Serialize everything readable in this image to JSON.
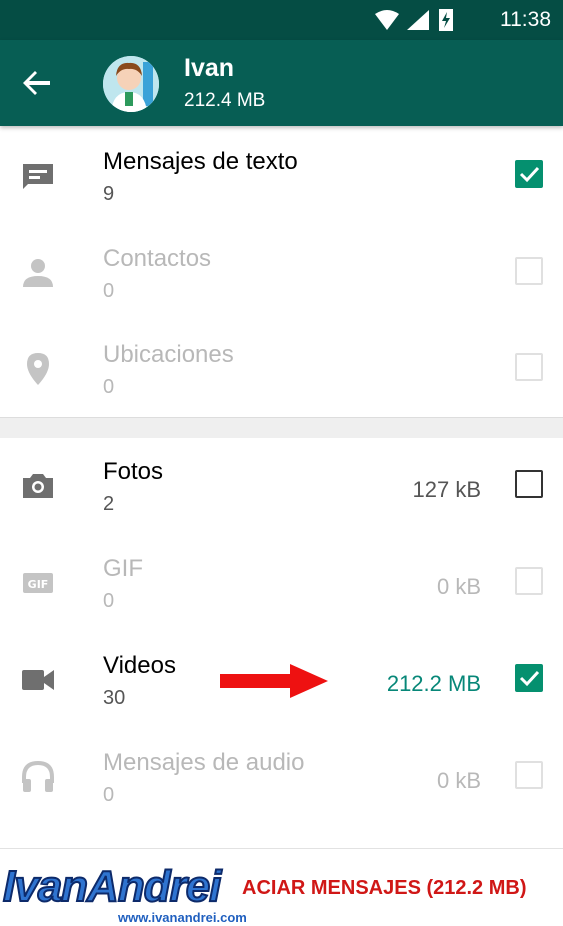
{
  "status_bar": {
    "time": "11:38"
  },
  "header": {
    "title": "Ivan",
    "subtitle": "212.4 MB"
  },
  "rows": [
    {
      "label": "Mensajes de texto",
      "count": "9",
      "size": "",
      "checked": true,
      "enabled": true,
      "icon": "message-icon"
    },
    {
      "label": "Contactos",
      "count": "0",
      "size": "",
      "checked": false,
      "enabled": false,
      "icon": "person-icon"
    },
    {
      "label": "Ubicaciones",
      "count": "0",
      "size": "",
      "checked": false,
      "enabled": false,
      "icon": "location-pin-icon"
    },
    {
      "label": "Fotos",
      "count": "2",
      "size": "127 kB",
      "checked": false,
      "enabled": true,
      "icon": "camera-icon"
    },
    {
      "label": "GIF",
      "count": "0",
      "size": "0 kB",
      "checked": false,
      "enabled": false,
      "icon": "gif-icon"
    },
    {
      "label": "Videos",
      "count": "30",
      "size": "212.2 MB",
      "checked": true,
      "enabled": true,
      "icon": "videocam-icon"
    },
    {
      "label": "Mensajes de audio",
      "count": "0",
      "size": "0 kB",
      "checked": false,
      "enabled": false,
      "icon": "headphones-icon"
    }
  ],
  "action": {
    "label": "ACIAR MENSAJES (212.2 MB)"
  },
  "watermark": {
    "brand": "IvanAndrei",
    "url": "www.ivanandrei.com"
  },
  "colors": {
    "primary": "#075e54",
    "status": "#054d44",
    "accent": "#05906f",
    "danger": "#d01716"
  }
}
